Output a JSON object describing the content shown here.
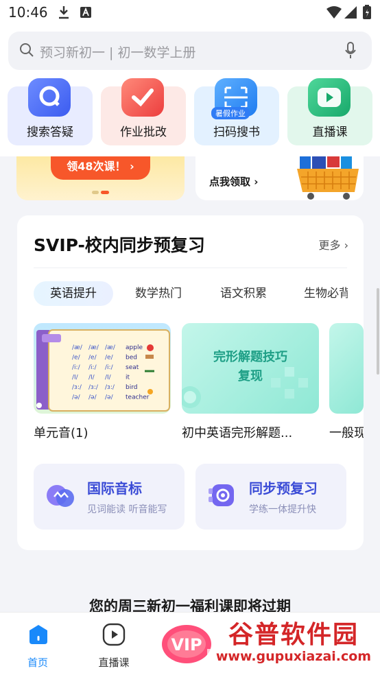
{
  "status_bar": {
    "time": "10:46"
  },
  "search": {
    "placeholder": "预习新初一 | 初一数学上册"
  },
  "quick_actions": [
    {
      "label": "搜索答疑",
      "icon": "search-answer-icon",
      "bg": "#e8ecff",
      "accent": "#4a6cf7"
    },
    {
      "label": "作业批改",
      "icon": "homework-check-icon",
      "bg": "#fde9e6",
      "accent": "#f0504a"
    },
    {
      "label": "扫码搜书",
      "icon": "scan-book-icon",
      "bg": "#e3f1ff",
      "accent": "#2f8df5",
      "badge": "暑假作业"
    },
    {
      "label": "直播课",
      "icon": "live-play-icon",
      "bg": "#e2f7ec",
      "accent": "#27b77a"
    }
  ],
  "banners": {
    "left": {
      "label": "领48次课！ ›"
    },
    "right": {
      "label": "点我领取 ›"
    }
  },
  "svip": {
    "title": "SVIP-校内同步预复习",
    "more": "更多 ›",
    "tabs": [
      "英语提升",
      "数学热门",
      "语文积累",
      "生物必背"
    ],
    "courses": [
      {
        "title": "单元音(1)"
      },
      {
        "title": "初中英语完形解题...",
        "thumb_text": "完形解题技巧\n复现"
      },
      {
        "title": "一般现在时"
      }
    ],
    "phonetics_rows": [
      [
        "/æ/",
        "/æ/",
        "/æ/",
        "apple"
      ],
      [
        "/e/",
        "/e/",
        "/e/",
        "bed"
      ],
      [
        "/i:/",
        "/i:/",
        "/i:/",
        "seat"
      ],
      [
        "/I/",
        "/I/",
        "/I/",
        "it"
      ],
      [
        "/ɜ:/",
        "/ɜ:/",
        "/ɜ:/",
        "bird"
      ],
      [
        "/ə/",
        "/ə/",
        "/ə/",
        "teacher"
      ]
    ],
    "features": [
      {
        "title": "国际音标",
        "subtitle": "见词能读 听音能写"
      },
      {
        "title": "同步预复习",
        "subtitle": "学练一体提升快"
      }
    ]
  },
  "expiring_notice": "您的周三新初一福利课即将过期",
  "bottom_nav": [
    {
      "label": "首页",
      "active": true
    },
    {
      "label": "直播课",
      "active": false
    }
  ],
  "vip_badge": "VIP",
  "watermark": {
    "main": "谷普软件园",
    "url": "www.gupuxiazai.com"
  }
}
